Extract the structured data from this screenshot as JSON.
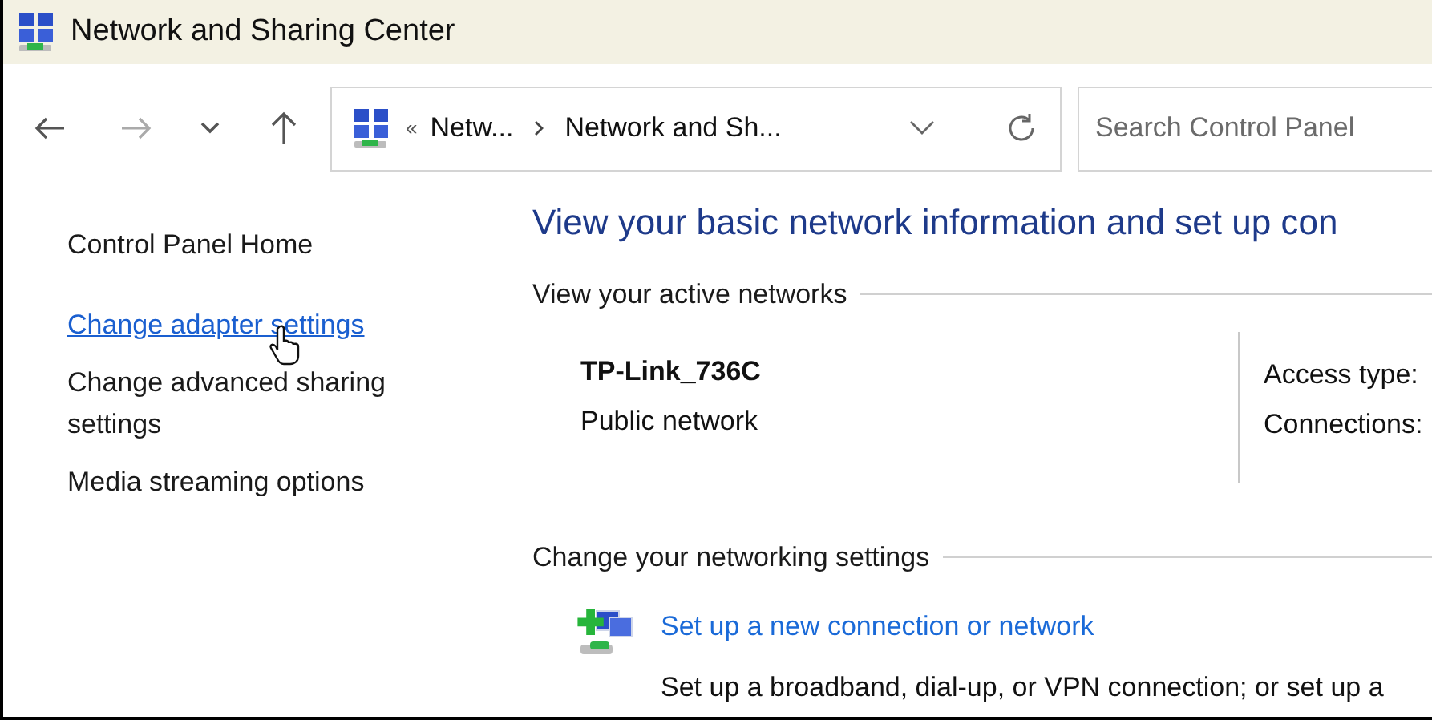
{
  "window": {
    "title": "Network and Sharing Center"
  },
  "address_bar": {
    "overflow": "«",
    "segments": [
      "Netw...",
      "Network and Sh..."
    ]
  },
  "search": {
    "placeholder": "Search Control Panel"
  },
  "sidebar": {
    "items": [
      {
        "label": "Control Panel Home",
        "kind": "text",
        "hovered": false
      },
      {
        "label": "Change adapter settings",
        "kind": "link",
        "hovered": true
      },
      {
        "label": "Change advanced sharing settings",
        "kind": "link",
        "hovered": false
      },
      {
        "label": "Media streaming options",
        "kind": "link",
        "hovered": false
      }
    ]
  },
  "main": {
    "heading": "View your basic network information and set up con",
    "active_networks": {
      "title": "View your active networks",
      "network_name": "TP-Link_736C",
      "network_type": "Public network",
      "fields": [
        "Access type:",
        "Connections:"
      ]
    },
    "networking_settings": {
      "title": "Change your networking settings",
      "items": [
        {
          "link": "Set up a new connection or network",
          "description": "Set up a broadband, dial-up, or VPN connection; or set up a"
        }
      ]
    }
  }
}
